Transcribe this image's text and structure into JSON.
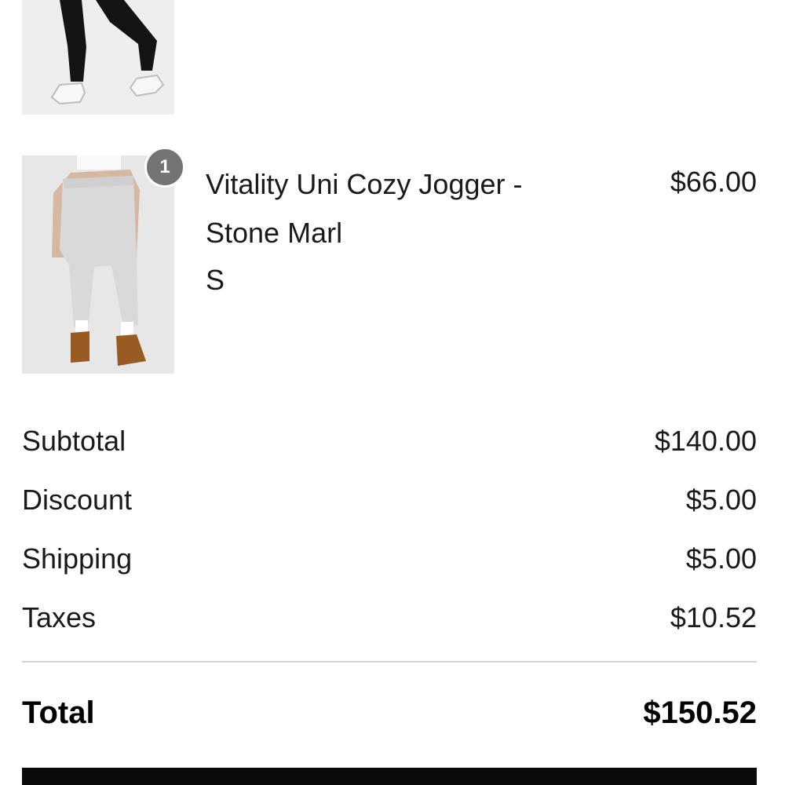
{
  "order": {
    "items": [
      {
        "name": "Vitality Uni Cozy Jogger - Stone Marl",
        "name_line1": "Vitality Uni Cozy Jogger -",
        "name_line2": "Stone Marl",
        "variant": "S",
        "price": "$66.00",
        "quantity": "1"
      }
    ]
  },
  "summary": {
    "subtotal_label": "Subtotal",
    "subtotal_value": "$140.00",
    "discount_label": "Discount",
    "discount_value": "$5.00",
    "shipping_label": "Shipping",
    "shipping_value": "$5.00",
    "taxes_label": "Taxes",
    "taxes_value": "$10.52",
    "total_label": "Total",
    "total_value": "$150.52"
  },
  "colors": {
    "badge": "#747474",
    "text": "#1a1a1a",
    "divider": "#d4d4d4",
    "button": "#0a0a0a"
  }
}
